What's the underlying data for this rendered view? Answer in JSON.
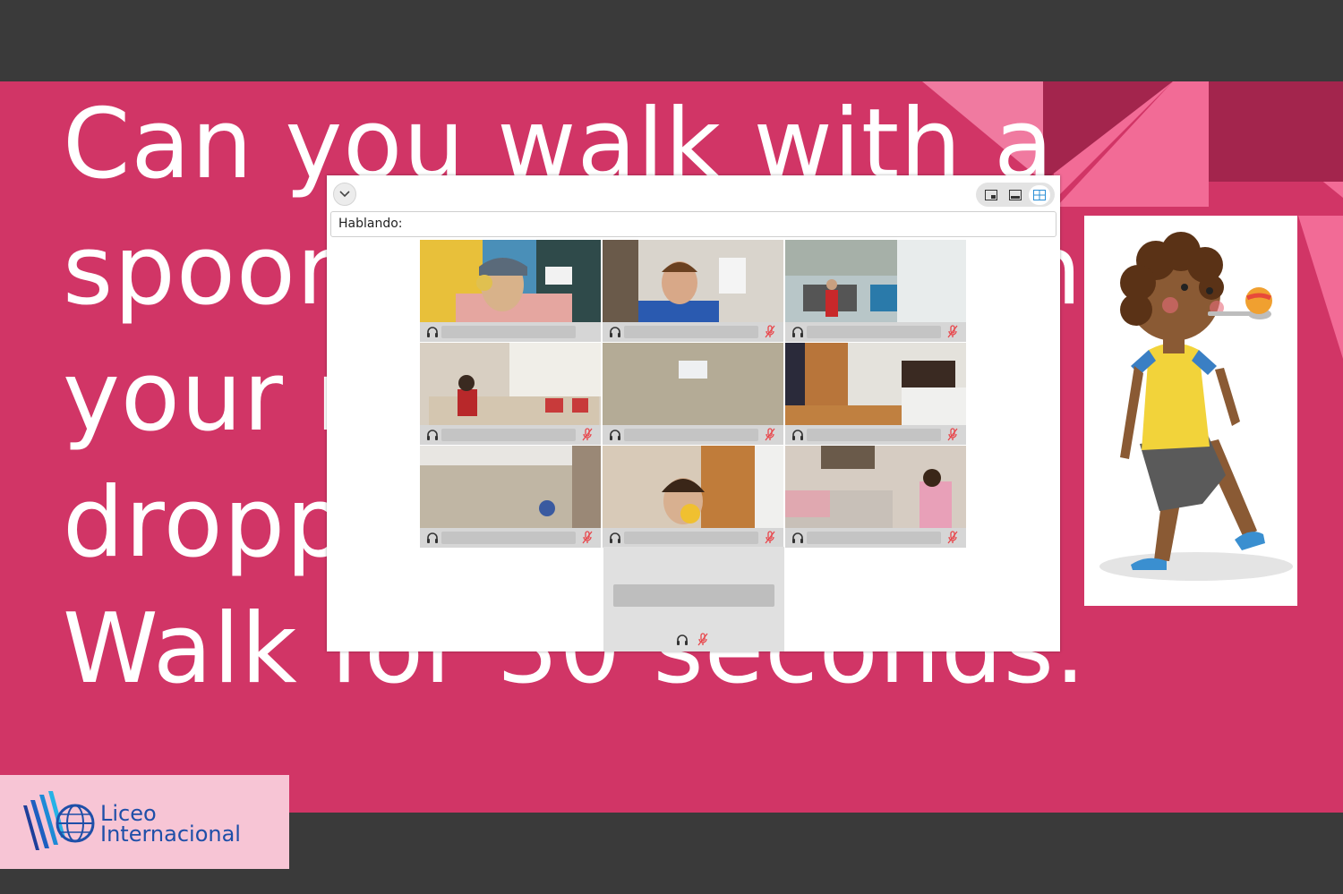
{
  "slide": {
    "text": "Can you walk with a\nspoon in your mouth\nyour not dropping\ndropping it?\nWalk for 30 seconds.",
    "colors": {
      "background": "#d13566",
      "text": "#ffffff"
    }
  },
  "logo": {
    "line1": "Liceo",
    "line2": "Internacional",
    "color": "#1e4fa8",
    "icon": "globe-books-icon"
  },
  "meeting": {
    "speaking_label": "Hablando:",
    "accent": "#2bb3e6",
    "muted_color": "#e8474c",
    "view_modes": [
      {
        "icon": "picture-in-picture-icon",
        "active": false
      },
      {
        "icon": "filmstrip-view-icon",
        "active": false
      },
      {
        "icon": "grid-view-icon",
        "active": true
      }
    ],
    "participants": [
      {
        "active_speaker": true,
        "muted": false
      },
      {
        "active_speaker": false,
        "muted": true
      },
      {
        "active_speaker": false,
        "muted": true
      },
      {
        "active_speaker": false,
        "muted": true
      },
      {
        "active_speaker": false,
        "muted": true
      },
      {
        "active_speaker": false,
        "muted": true
      },
      {
        "active_speaker": false,
        "muted": true
      },
      {
        "active_speaker": false,
        "muted": true
      },
      {
        "active_speaker": false,
        "muted": true
      },
      {
        "active_speaker": false,
        "muted": true
      }
    ]
  }
}
